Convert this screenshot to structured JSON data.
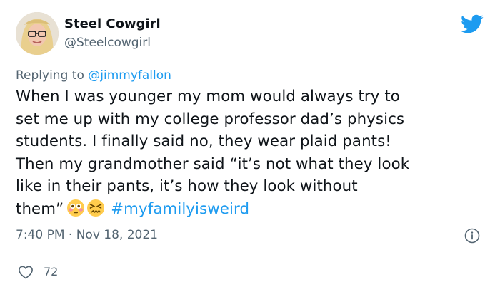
{
  "author": {
    "display_name": "Steel Cowgirl",
    "handle": "@Steelcowgirl"
  },
  "icons": {
    "brand": "twitter-bird-icon",
    "info": "info-icon",
    "like": "heart-icon",
    "emoji_1": "flushed-face-emoji",
    "emoji_2": "confounded-face-emoji"
  },
  "reply": {
    "prefix": "Replying to",
    "mention": "@jimmyfallon"
  },
  "tweet": {
    "lines": [
      "When I was younger my mom would always try to",
      "set me up with my college professor dad’s physics",
      "students. I finally said no, they wear plaid pants!",
      "Then my grandmother said “it’s not what they look",
      "like in their pants, it’s how they look without",
      "them”"
    ],
    "hashtag": "#myfamilyisweird"
  },
  "meta": {
    "timestamp": "7:40 PM · Nov 18, 2021"
  },
  "engagement": {
    "likes": "72"
  },
  "colors": {
    "brand_blue": "#1d9bf0",
    "text": "#0f1419",
    "muted": "#536471",
    "divider": "#cfd9de"
  }
}
